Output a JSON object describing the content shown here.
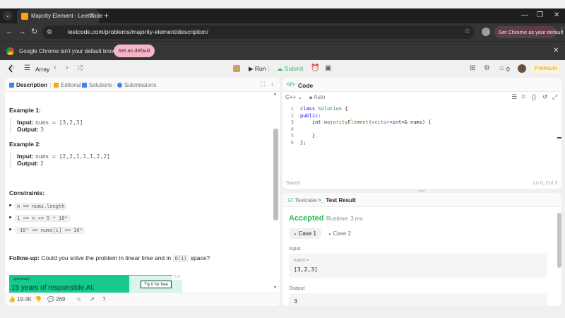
{
  "browser": {
    "tab_title": "Majority Element - LeetCode",
    "new_tab_icon": "+",
    "url": "leetcode.com/problems/majority-element/description/",
    "set_default_button": "Set Chrome as your default",
    "infobar_text": "Google Chrome isn't your default browser",
    "infobar_button": "Set as default"
  },
  "leetcode_nav": {
    "problem_list_label": "Array",
    "run_label": "Run",
    "submit_label": "Submit",
    "streak_count": "0",
    "premium_label": "Premium",
    "accent_color": "#2cbb5d",
    "premium_color": "#e0a200"
  },
  "left_panel": {
    "tabs": [
      "Description",
      "Editorial",
      "Solutions",
      "Submissions"
    ],
    "examples": [
      {
        "title": "Example 1:",
        "input_label": "Input:",
        "input_value": "nums = [3,2,3]",
        "output_label": "Output:",
        "output_value": "3"
      },
      {
        "title": "Example 2:",
        "input_label": "Input:",
        "input_value": "nums = [2,2,1,1,1,2,2]",
        "output_label": "Output:",
        "output_value": "2"
      }
    ],
    "constraints_title": "Constraints:",
    "constraints": [
      "n == nums.length",
      "1 <= n <= 5 * 10⁴",
      "-10⁹ <= nums[i] <= 10⁹"
    ],
    "followup_label": "Follow-up:",
    "followup_text": "Could you solve the problem in linear time and in",
    "followup_code": "O(1)",
    "followup_end": "space?",
    "ad": {
      "brand": "grammarly",
      "headline": "15 years of responsible AI.",
      "cta": "Try it for free"
    },
    "footer": {
      "likes": "19.4K",
      "comments": "269"
    }
  },
  "code_panel": {
    "title": "Code",
    "language": "C++",
    "mode": "Auto",
    "lines": [
      {
        "n": "1",
        "text": "class Solution {"
      },
      {
        "n": "2",
        "text": "public:"
      },
      {
        "n": "3",
        "text": "    int majorityElement(vector<int>& nums) {"
      },
      {
        "n": "4",
        "text": ""
      },
      {
        "n": "5",
        "text": "    }"
      },
      {
        "n": "6",
        "text": "};"
      }
    ],
    "status": "Saved",
    "cursor": "Ln 6, Col 3"
  },
  "result_panel": {
    "tabs": [
      "Testcase",
      "Test Result"
    ],
    "verdict": "Accepted",
    "runtime": "Runtime: 3 ms",
    "cases": [
      "Case 1",
      "Case 2"
    ],
    "input_label": "Input",
    "input_var": "nums =",
    "input_value": "[3,2,3]",
    "output_label": "Output",
    "output_value": "3"
  }
}
